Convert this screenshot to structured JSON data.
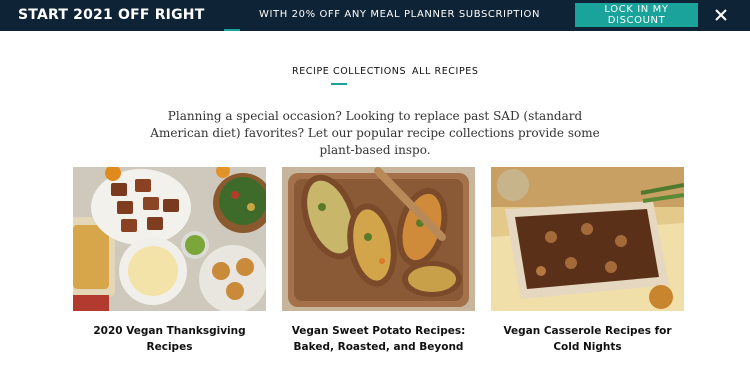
{
  "promo": {
    "headline": "START 2021 OFF RIGHT",
    "subtext": "WITH 20% OFF ANY MEAL PLANNER SUBSCRIPTION",
    "cta_label": "LOCK IN MY DISCOUNT",
    "close_icon": "close-icon",
    "background_color": "#0f2336",
    "cta_color": "#1aa39a"
  },
  "tabs": [
    {
      "label": "RECIPE COLLECTIONS",
      "active": true
    },
    {
      "label": "ALL RECIPES",
      "active": false
    }
  ],
  "intro_text": "Planning a special occasion? Looking to replace past SAD (standard American diet) favorites? Let our popular recipe collections provide some plant-based inspo.",
  "collections": [
    {
      "title": "2020 Vegan Thanksgiving Recipes"
    },
    {
      "title": "Vegan Sweet Potato Recipes: Baked, Roasted, and Beyond"
    },
    {
      "title": "Vegan Casserole Recipes for Cold Nights"
    }
  ],
  "accent_color": "#1aa39a"
}
